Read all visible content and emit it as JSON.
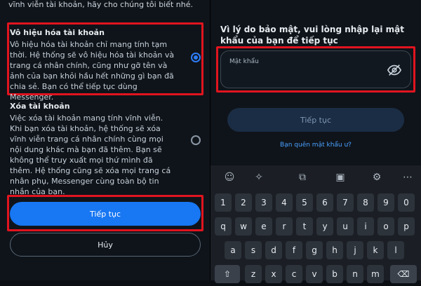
{
  "left": {
    "top_text": "vĩnh viễn tài khoản, hãy cho chúng tôi biết nhé.",
    "options": [
      {
        "title": "Vô hiệu hóa tài khoản",
        "description": "Vô hiệu hóa tài khoản chỉ mang tính tạm thời. Hệ thống sẽ vô hiệu hóa tài khoản và trang cá nhân chính, cũng như gỡ tên và ảnh của bạn khỏi hầu hết những gì bạn đã chia sẻ. Bạn có thể tiếp tục dùng Messenger.",
        "selected": true
      },
      {
        "title": "Xóa tài khoản",
        "description": "Việc xóa tài khoản mang tính vĩnh viễn. Khi bạn xóa tài khoản, hệ thống sẽ xóa vĩnh viễn trang cá nhân chính cùng mọi nội dung khác mà bạn đã thêm. Bạn sẽ không thể truy xuất mọi thứ mình đã thêm. Hệ thống cũng sẽ xóa mọi trang cá nhân phụ, Messenger cùng toàn bộ tin nhắn của bạn.",
        "selected": false
      }
    ],
    "continue_label": "Tiếp tục",
    "cancel_label": "Hủy"
  },
  "right": {
    "instruction": "Vì lý do bảo mật, vui lòng nhập lại mật khẩu của bạn để tiếp tục",
    "password_placeholder": "Mật khẩu",
    "continue_label": "Tiếp tục",
    "forgot_label": "Bạn quên mật khẩu ư?",
    "keyboard": {
      "row_numbers": [
        "1",
        "2",
        "3",
        "4",
        "5",
        "6",
        "7",
        "8",
        "9",
        "0"
      ],
      "row_q": [
        "q",
        "w",
        "e",
        "r",
        "t",
        "y",
        "u",
        "i",
        "o",
        "p"
      ],
      "row_a": [
        "a",
        "s",
        "d",
        "f",
        "g",
        "h",
        "j",
        "k",
        "l"
      ],
      "row_z": [
        "z",
        "x",
        "c",
        "v",
        "b",
        "n",
        "m"
      ]
    }
  },
  "colors": {
    "accent": "#1877f2",
    "highlight_box": "#e1141f",
    "link": "#4aa0ff"
  }
}
